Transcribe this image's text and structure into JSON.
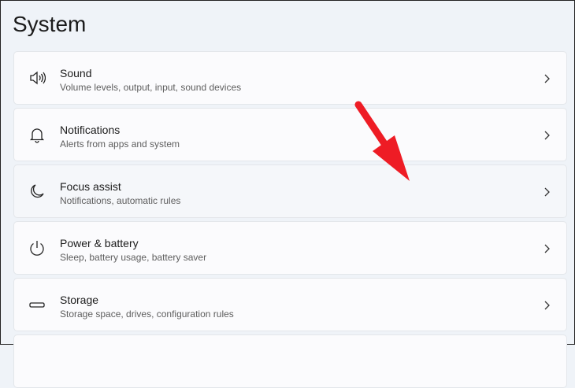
{
  "page_title": "System",
  "items": [
    {
      "label": "Sound",
      "desc": "Volume levels, output, input, sound devices",
      "icon": "speaker-icon"
    },
    {
      "label": "Notifications",
      "desc": "Alerts from apps and system",
      "icon": "bell-icon"
    },
    {
      "label": "Focus assist",
      "desc": "Notifications, automatic rules",
      "icon": "moon-icon"
    },
    {
      "label": "Power & battery",
      "desc": "Sleep, battery usage, battery saver",
      "icon": "power-icon"
    },
    {
      "label": "Storage",
      "desc": "Storage space, drives, configuration rules",
      "icon": "drive-icon"
    }
  ],
  "annotation_color": "#ee1c25"
}
